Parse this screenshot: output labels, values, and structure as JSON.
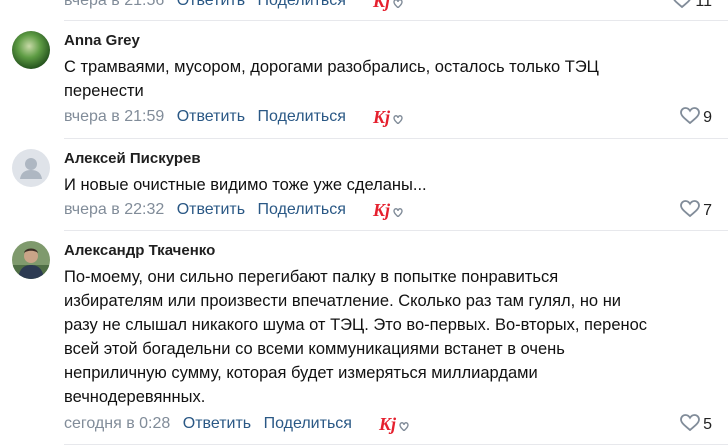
{
  "comments": [
    {
      "author": "",
      "lines": [],
      "date": "вчера в 21:56",
      "reply": "Ответить",
      "share": "Поделиться",
      "likes": "11"
    },
    {
      "author": "Anna Grey",
      "lines": [
        "С трамваями, мусором, дорогами разобрались, осталось только ТЭЦ",
        "перенести"
      ],
      "date": "вчера в 21:59",
      "reply": "Ответить",
      "share": "Поделиться",
      "likes": "9"
    },
    {
      "author": "Алексей Пискурев",
      "lines": [
        "И новые очистные видимо тоже уже сделаны..."
      ],
      "date": "вчера в 22:32",
      "reply": "Ответить",
      "share": "Поделиться",
      "likes": "7"
    },
    {
      "author": "Александр Ткаченко",
      "lines": [
        "По-моему, они сильно перегибают палку в попытке понравиться",
        "избирателям или произвести впечатление. Сколько раз там гулял, но ни",
        "разу не слышал никакого шума от ТЭЦ. Это во-первых. Во-вторых, перенос",
        "всей этой богадельни со всеми коммуникациями встанет в очень",
        "неприличную сумму, которая будет измеряться миллиардами",
        "вечнодеревянных."
      ],
      "date": "сегодня в 0:28",
      "reply": "Ответить",
      "share": "Поделиться",
      "likes": "5"
    }
  ],
  "colors": {
    "link": "#2a5885",
    "muted": "#818c99",
    "kg_red": "#e5202e"
  },
  "icons": {
    "like": "heart-outline-icon",
    "reaction": "kg-heart-logo-icon",
    "placeholder_avatar": "user-silhouette-icon"
  }
}
